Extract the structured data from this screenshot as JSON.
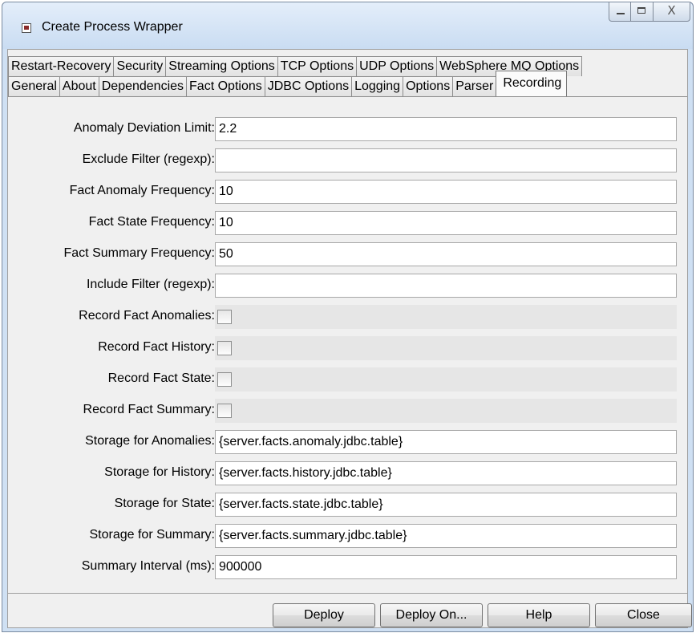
{
  "window": {
    "title": "Create Process Wrapper"
  },
  "tabs": {
    "row1": [
      "Restart-Recovery",
      "Security",
      "Streaming Options",
      "TCP Options",
      "UDP Options",
      "WebSphere MQ Options"
    ],
    "row2": [
      "General",
      "About",
      "Dependencies",
      "Fact Options",
      "JDBC Options",
      "Logging",
      "Options",
      "Parser",
      "Recording"
    ],
    "active": "Recording"
  },
  "form": {
    "anomaly_deviation_limit": {
      "label": "Anomaly Deviation Limit:",
      "value": "2.2"
    },
    "exclude_filter": {
      "label": "Exclude Filter (regexp):",
      "value": ""
    },
    "fact_anomaly_frequency": {
      "label": "Fact Anomaly Frequency:",
      "value": "10"
    },
    "fact_state_frequency": {
      "label": "Fact State Frequency:",
      "value": "10"
    },
    "fact_summary_frequency": {
      "label": "Fact Summary Frequency:",
      "value": "50"
    },
    "include_filter": {
      "label": "Include Filter (regexp):",
      "value": ""
    },
    "record_fact_anomalies": {
      "label": "Record Fact Anomalies:",
      "checked": false
    },
    "record_fact_history": {
      "label": "Record Fact History:",
      "checked": false
    },
    "record_fact_state": {
      "label": "Record Fact State:",
      "checked": false
    },
    "record_fact_summary": {
      "label": "Record Fact Summary:",
      "checked": false
    },
    "storage_for_anomalies": {
      "label": "Storage for Anomalies:",
      "value": "{server.facts.anomaly.jdbc.table}"
    },
    "storage_for_history": {
      "label": "Storage for History:",
      "value": "{server.facts.history.jdbc.table}"
    },
    "storage_for_state": {
      "label": "Storage for State:",
      "value": "{server.facts.state.jdbc.table}"
    },
    "storage_for_summary": {
      "label": "Storage for Summary:",
      "value": "{server.facts.summary.jdbc.table}"
    },
    "summary_interval": {
      "label": "Summary Interval (ms):",
      "value": "900000"
    }
  },
  "buttons": {
    "deploy": "Deploy",
    "deploy_on": "Deploy On...",
    "help": "Help",
    "close": "Close"
  },
  "caption": {
    "close_glyph": "X"
  },
  "colors": {
    "titlebar": "#c9dcf2",
    "client": "#f0f0f0",
    "field_bg": "#ffffff"
  }
}
